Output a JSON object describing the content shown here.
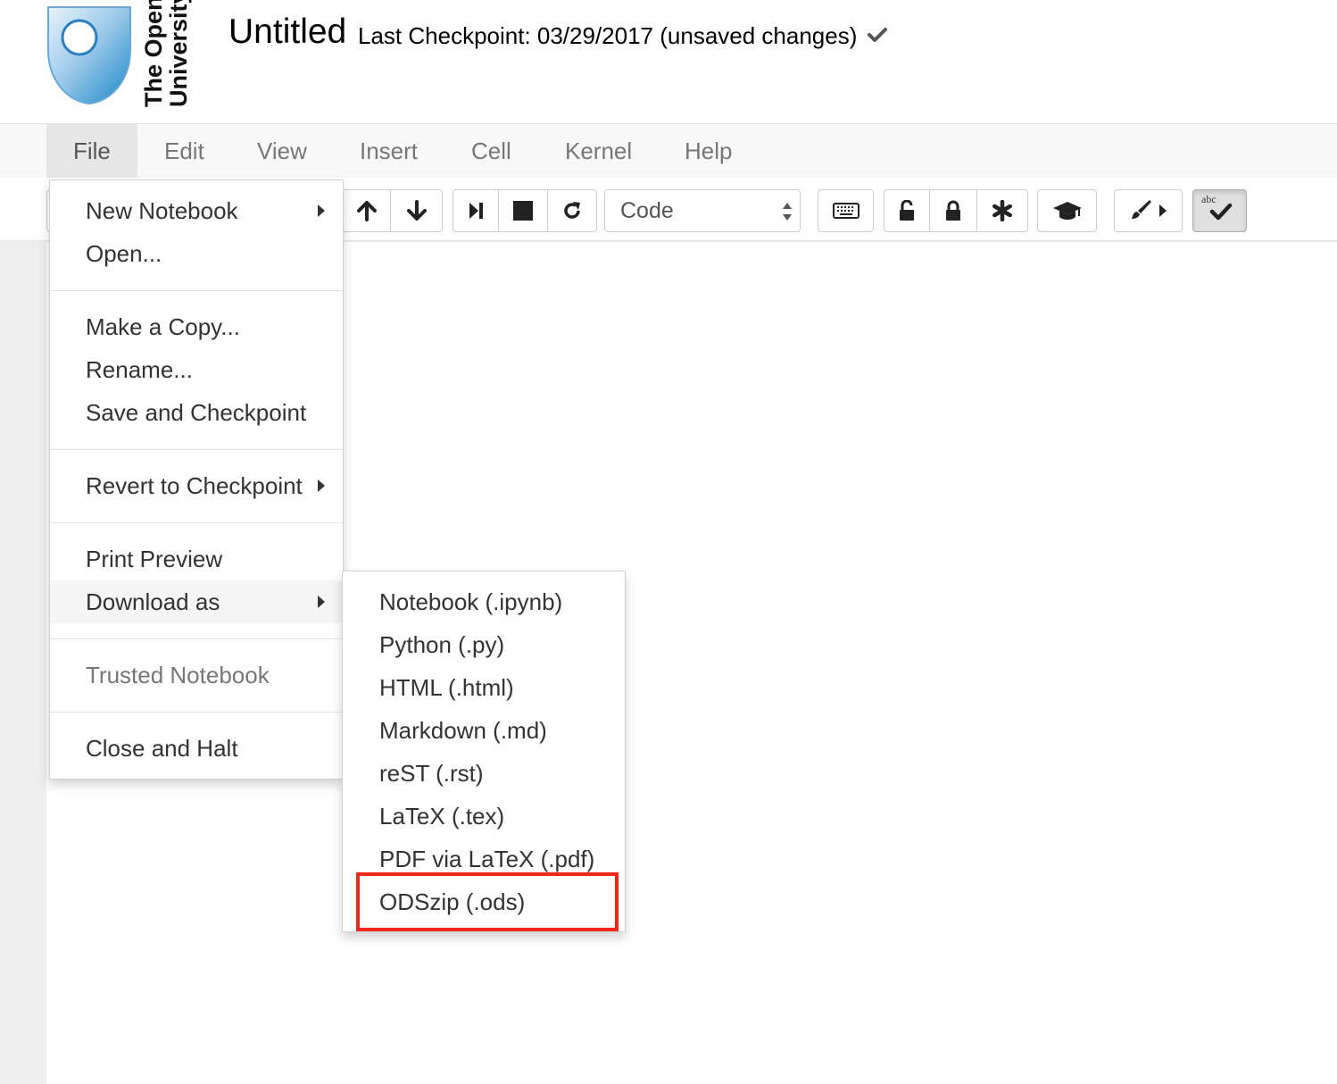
{
  "header": {
    "logo_text_line1": "The Open",
    "logo_text_line2": "University",
    "notebook_name": "Untitled",
    "checkpoint_status": "Last Checkpoint: 03/29/2017 (unsaved changes)",
    "checkpoint_icon": "check-icon"
  },
  "menubar": {
    "items": [
      {
        "label": "File",
        "open": true
      },
      {
        "label": "Edit"
      },
      {
        "label": "View"
      },
      {
        "label": "Insert"
      },
      {
        "label": "Cell"
      },
      {
        "label": "Kernel"
      },
      {
        "label": "Help"
      }
    ]
  },
  "toolbar": {
    "icons": [
      "arrow-up-icon",
      "arrow-down-icon",
      "step-forward-icon",
      "stop-icon",
      "restart-icon",
      "keyboard-icon",
      "unlock-icon",
      "lock-icon",
      "asterisk-icon",
      "graduation-cap-icon",
      "paint-brush-icon",
      "caret-right-icon",
      "spellcheck-icon"
    ],
    "cell_type_value": "Code",
    "spellcheck_label": "abc",
    "spellcheck_active": true
  },
  "file_menu": {
    "items": [
      {
        "label": "New Notebook",
        "submenu": true
      },
      {
        "label": "Open..."
      },
      {
        "label": "Make a Copy..."
      },
      {
        "label": "Rename..."
      },
      {
        "label": "Save and Checkpoint"
      },
      {
        "label": "Revert to Checkpoint",
        "submenu": true
      },
      {
        "label": "Print Preview"
      },
      {
        "label": "Download as",
        "submenu": true,
        "active": true
      },
      {
        "label": "Trusted Notebook",
        "disabled": true
      },
      {
        "label": "Close and Halt"
      }
    ]
  },
  "download_menu": {
    "items": [
      {
        "label": "Notebook (.ipynb)"
      },
      {
        "label": "Python (.py)"
      },
      {
        "label": "HTML (.html)"
      },
      {
        "label": "Markdown (.md)"
      },
      {
        "label": "reST (.rst)"
      },
      {
        "label": "LaTeX (.tex)"
      },
      {
        "label": "PDF via LaTeX (.pdf)"
      },
      {
        "label": "ODSzip (.ods)",
        "highlighted": true
      }
    ]
  },
  "colors": {
    "highlight_border": "#f0281a",
    "logo_blue": "#1a87c9"
  }
}
